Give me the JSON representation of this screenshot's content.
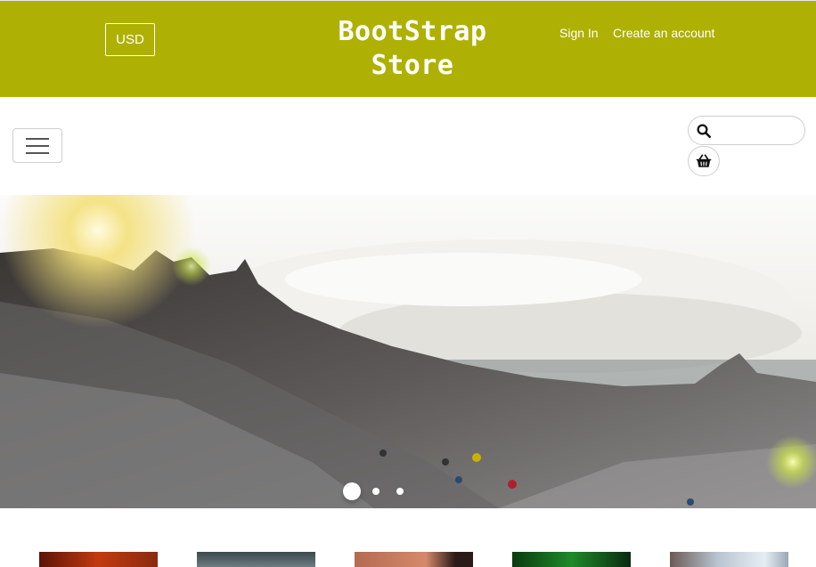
{
  "header": {
    "currency_label": "USD",
    "brand_line1": "BootStrap",
    "brand_line2": "Store",
    "sign_in": "Sign In",
    "create_account": "Create an account"
  },
  "navbar": {
    "search_placeholder": "",
    "icons": {
      "menu": "hamburger-menu-icon",
      "search": "search-icon",
      "cart": "basket-icon"
    }
  },
  "carousel": {
    "slide_count": 3,
    "active_index": 0
  },
  "thumbnails": [
    {
      "name": "thumbnail-1"
    },
    {
      "name": "thumbnail-2"
    },
    {
      "name": "thumbnail-3"
    },
    {
      "name": "thumbnail-4"
    },
    {
      "name": "thumbnail-5"
    }
  ],
  "colors": {
    "header_bg": "#aeb004",
    "header_text": "#ffffff"
  }
}
